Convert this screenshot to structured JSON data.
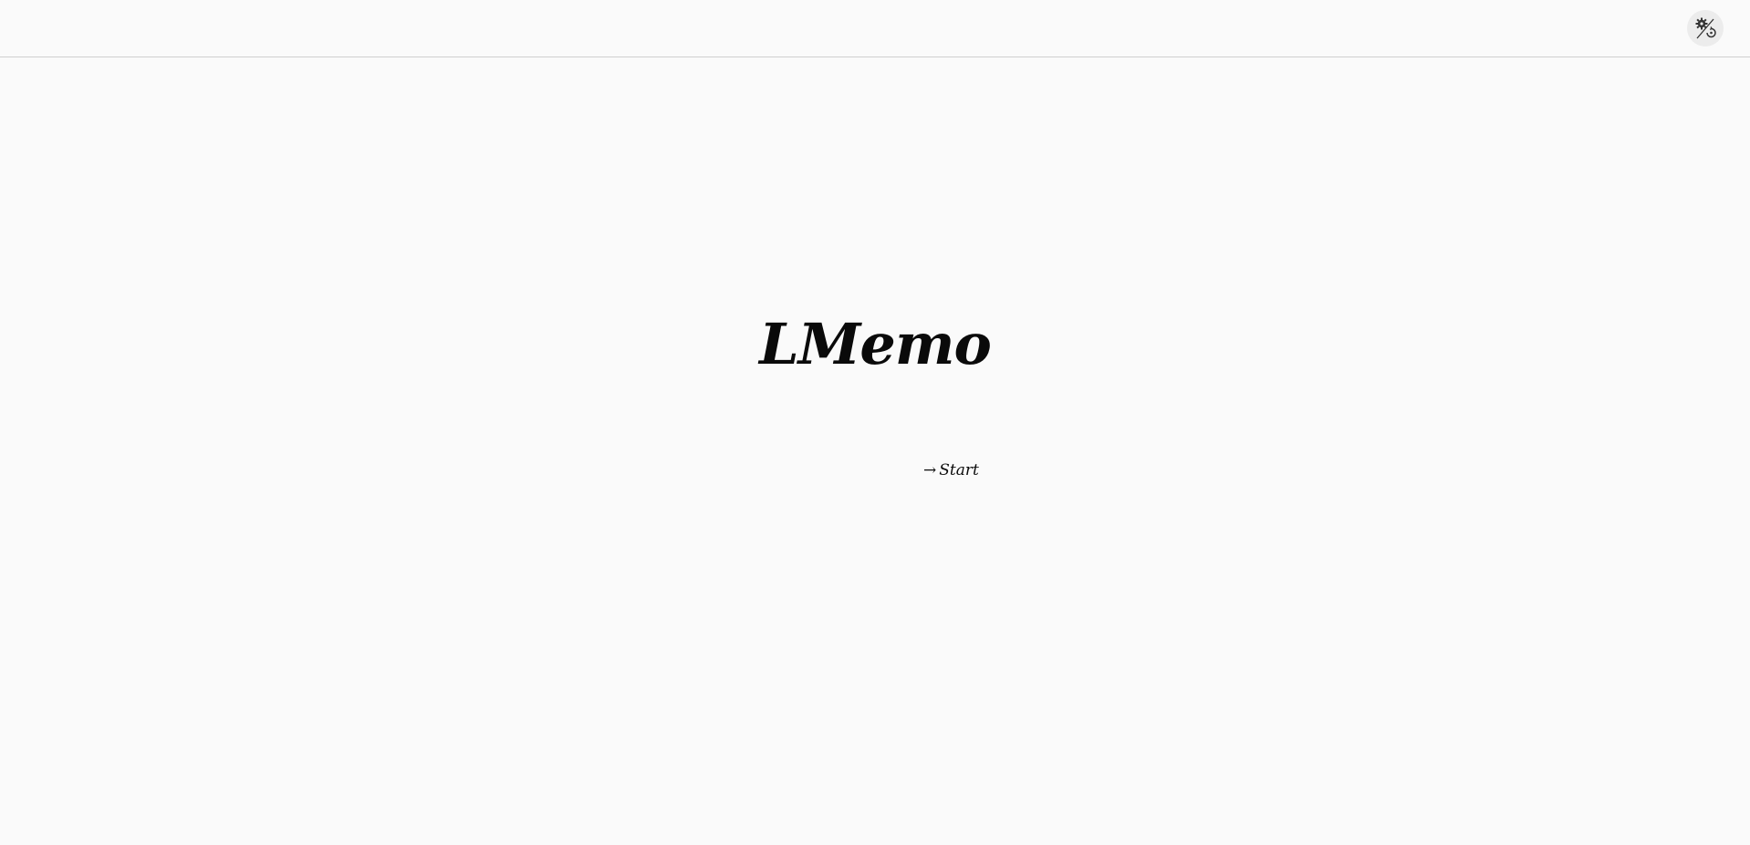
{
  "header": {
    "settings_icon": "settings-gear-icon"
  },
  "main": {
    "title": "LMemo",
    "start_arrow": "→",
    "start_label": "Start"
  }
}
